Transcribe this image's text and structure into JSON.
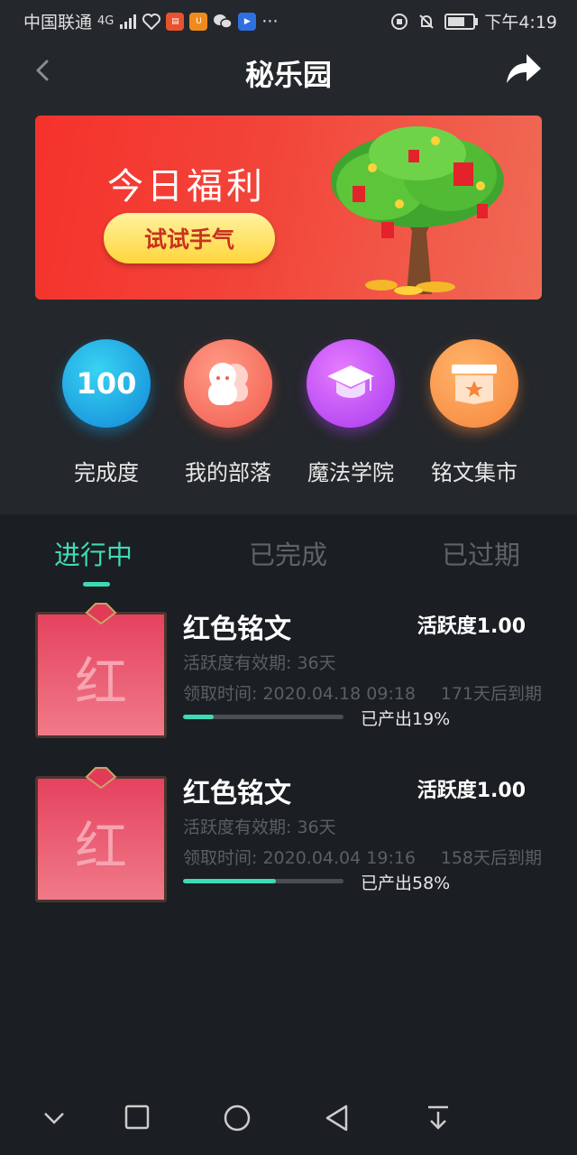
{
  "status_bar": {
    "carrier": "中国联通",
    "network": "4G",
    "time": "下午4:19"
  },
  "header": {
    "title": "秘乐园"
  },
  "banner": {
    "title": "今日福利",
    "button_label": "试试手气"
  },
  "quick_links": [
    {
      "label": "完成度",
      "value": "100",
      "icon": "completion-badge",
      "color": "#1e9be2"
    },
    {
      "label": "我的部落",
      "icon": "tribe-icon",
      "color": "#f26a5a"
    },
    {
      "label": "魔法学院",
      "icon": "graduation-cap-icon",
      "color": "#b447f0"
    },
    {
      "label": "铭文集市",
      "icon": "market-box-icon",
      "color": "#f7913f"
    }
  ],
  "tabs": [
    {
      "label": "进行中",
      "active": true
    },
    {
      "label": "已完成",
      "active": false
    },
    {
      "label": "已过期",
      "active": false
    }
  ],
  "items": [
    {
      "thumb_char": "红",
      "name": "红色铭文",
      "activity": "活跃度1.00",
      "validity": "活跃度有效期: 36天",
      "received": "领取时间: 2020.04.18 09:18",
      "expire": "171天后到期",
      "progress": 0.19,
      "produced": "已产出19%"
    },
    {
      "thumb_char": "红",
      "name": "红色铭文",
      "activity": "活跃度1.00",
      "validity": "活跃度有效期: 36天",
      "received": "领取时间: 2020.04.04 19:16",
      "expire": "158天后到期",
      "progress": 0.58,
      "produced": "已产出58%"
    }
  ],
  "colors": {
    "accent": "#3ddbb5",
    "background": "#1b1e22",
    "header_bg": "#24272b"
  }
}
